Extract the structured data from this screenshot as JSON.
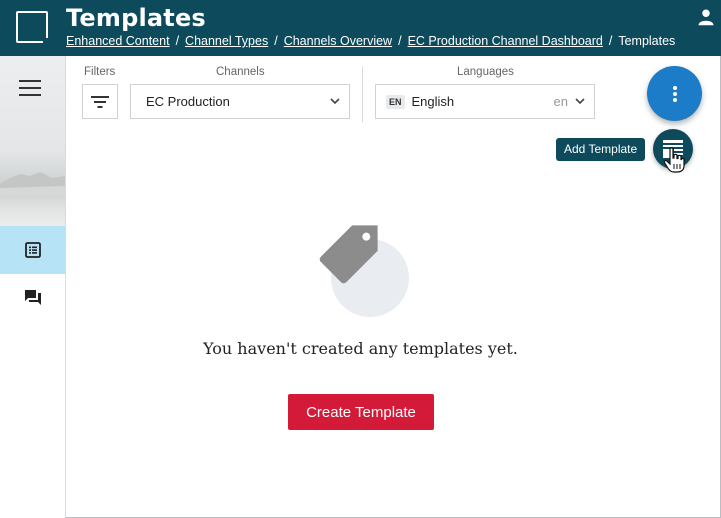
{
  "header": {
    "title": "Templates",
    "breadcrumb": [
      "Enhanced Content",
      "Channel Types",
      "Channels Overview",
      "EC Production Channel Dashboard"
    ],
    "breadcrumb_current": "Templates",
    "separator": "/"
  },
  "filters": {
    "filters_label": "Filters",
    "channels_label": "Channels",
    "channels_value": "EC Production",
    "languages_label": "Languages",
    "language_badge": "EN",
    "language_value": "English",
    "language_code": "en"
  },
  "fab": {
    "tooltip": "Add Template"
  },
  "empty_state": {
    "message": "You haven't created any templates yet.",
    "create_button": "Create Template"
  },
  "icons": {
    "menu": "hamburger-menu-icon",
    "nav1": "list-document-icon",
    "nav2": "chat-icon",
    "user": "user-icon",
    "filter": "filter-icon",
    "more": "more-vertical-icon",
    "add_template": "template-add-icon",
    "tag": "tag-icon"
  },
  "colors": {
    "header_bg": "#0d4a5c",
    "accent": "#1c7cc7",
    "nav_active": "#b7e3f7",
    "primary_button": "#d31a38"
  }
}
